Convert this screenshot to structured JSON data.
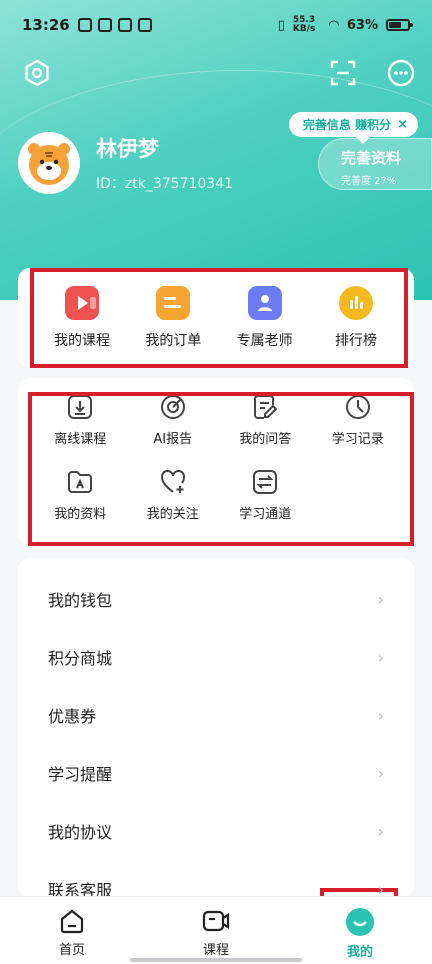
{
  "status_bar": {
    "time": "13:26",
    "network_speed": "55.3 KB/s",
    "battery": "63%"
  },
  "profile": {
    "name": "林伊梦",
    "id_text": "ID：ztk_375710341"
  },
  "tip": {
    "text": "完善信息 赚积分",
    "close": "×"
  },
  "complete": {
    "title": "完善资料",
    "subtitle": "完善度 27%"
  },
  "primary_grid": [
    {
      "label": "我的课程",
      "icon": "play-video-icon",
      "color": "#f0534f"
    },
    {
      "label": "我的订单",
      "icon": "order-icon",
      "color": "#f7a531"
    },
    {
      "label": "专属老师",
      "icon": "teacher-icon",
      "color": "#6b7cf2"
    },
    {
      "label": "排行榜",
      "icon": "ranking-icon",
      "color": "#f5b81f"
    }
  ],
  "secondary_grid": [
    {
      "label": "离线课程",
      "icon": "download-icon"
    },
    {
      "label": "AI报告",
      "icon": "ai-report-icon"
    },
    {
      "label": "我的问答",
      "icon": "qa-edit-icon"
    },
    {
      "label": "学习记录",
      "icon": "clock-icon"
    },
    {
      "label": "我的资料",
      "icon": "pdf-folder-icon"
    },
    {
      "label": "我的关注",
      "icon": "heart-plus-icon"
    },
    {
      "label": "学习通道",
      "icon": "switch-channel-icon"
    }
  ],
  "menu_list": [
    {
      "label": "我的钱包"
    },
    {
      "label": "积分商城"
    },
    {
      "label": "优惠券"
    },
    {
      "label": "学习提醒"
    },
    {
      "label": "我的协议"
    },
    {
      "label": "联系客服"
    }
  ],
  "tabbar": [
    {
      "label": "首页",
      "icon": "home-icon"
    },
    {
      "label": "课程",
      "icon": "course-video-icon"
    },
    {
      "label": "我的",
      "icon": "profile-smile-icon",
      "active": true
    }
  ],
  "colors": {
    "accent": "#13b3a0",
    "highlight_border": "#d81e2a"
  }
}
